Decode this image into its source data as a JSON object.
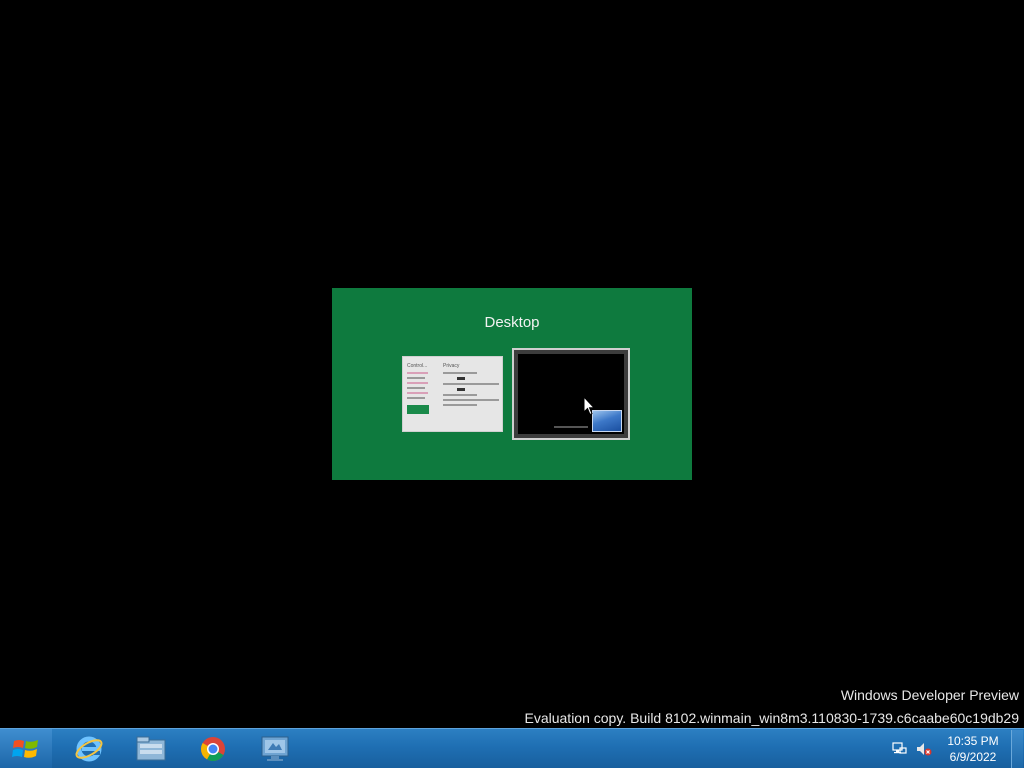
{
  "switcher": {
    "title": "Desktop",
    "thumbnails": [
      {
        "name": "Control Panel",
        "left_header": "Control...",
        "right_header": "Privacy"
      },
      {
        "name": "Desktop"
      }
    ]
  },
  "watermark": {
    "line1": "Windows Developer Preview",
    "line2": "Evaluation copy. Build 8102.winmain_win8m3.110830-1739.c6caabe60c19db29"
  },
  "taskbar": {
    "start": "start-orb-icon",
    "pinned": [
      {
        "name": "internet-explorer-icon"
      },
      {
        "name": "file-explorer-icon"
      },
      {
        "name": "chrome-icon"
      },
      {
        "name": "remote-desktop-icon"
      }
    ],
    "tray": {
      "network": "network-icon",
      "volume": "volume-muted-icon",
      "time": "10:35 PM",
      "date": "6/9/2022"
    }
  },
  "colors": {
    "switcher_bg": "#0e7a3e",
    "taskbar_bg": "#1f6fb3",
    "desktop_bg": "#000000"
  }
}
